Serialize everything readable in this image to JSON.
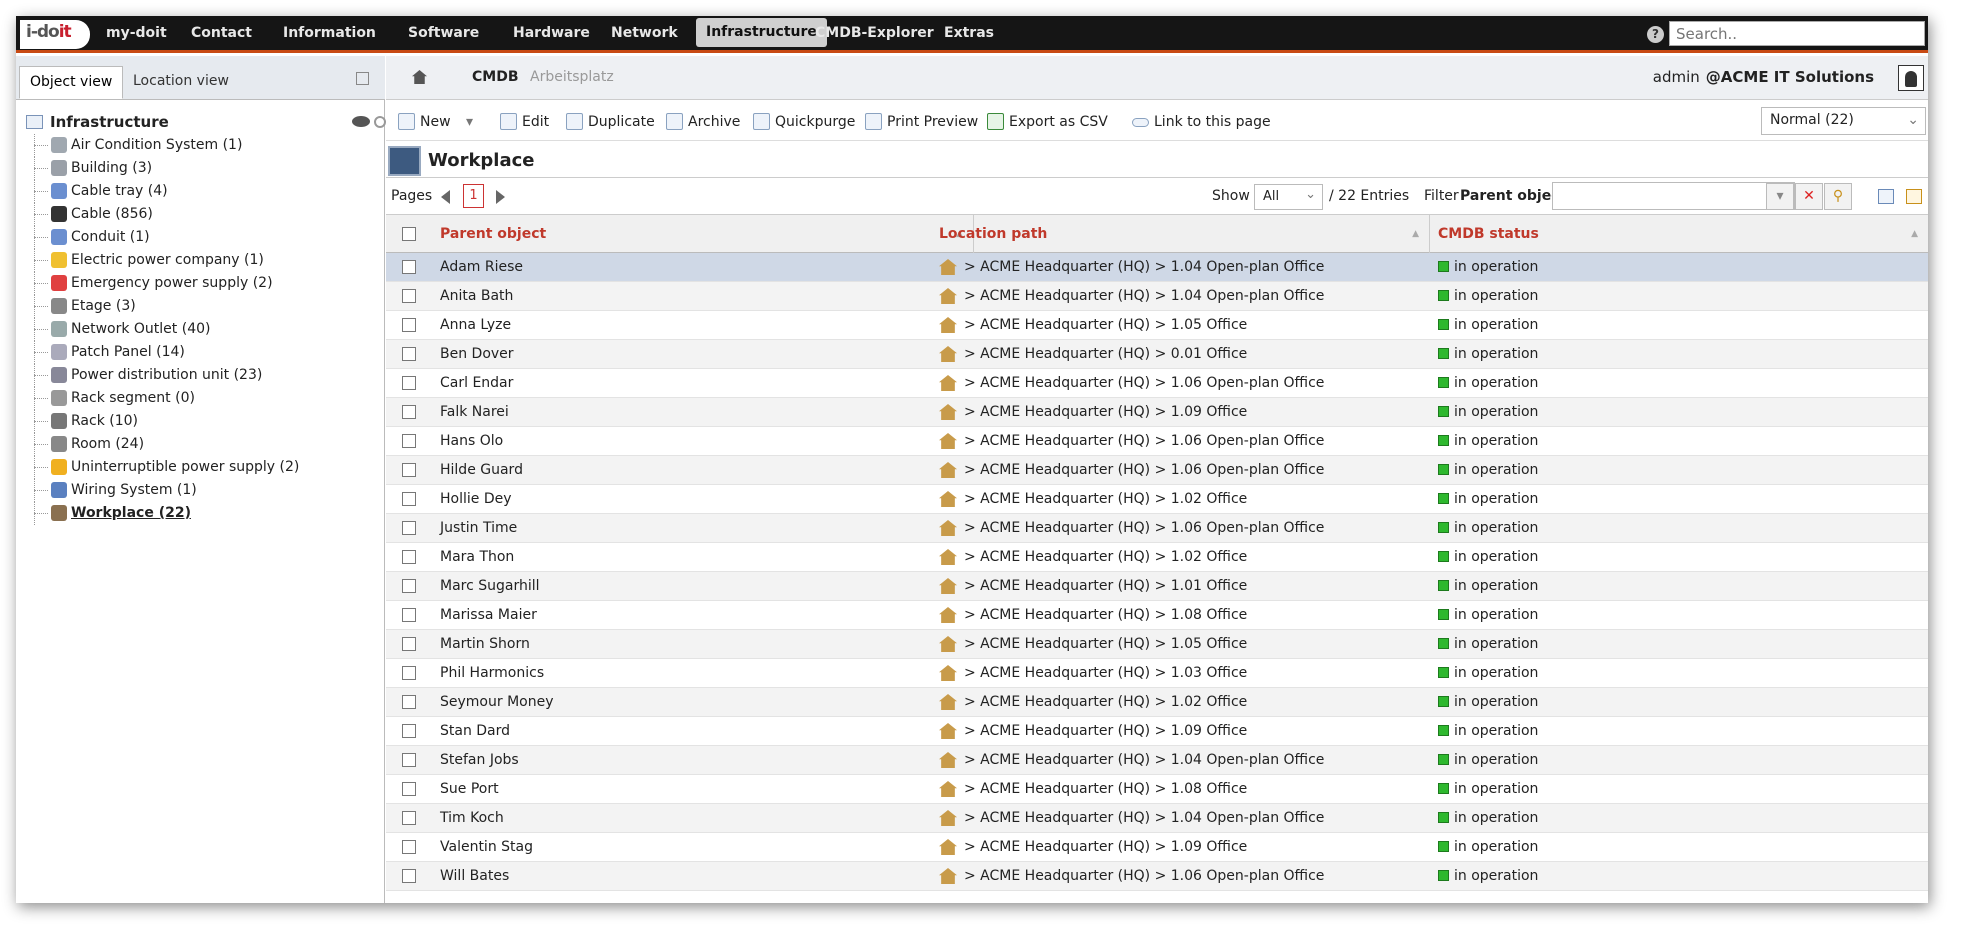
{
  "logo": {
    "text_a": "i-do",
    "text_b": "it"
  },
  "nav": [
    "my-doit",
    "Contact",
    "Information",
    "Software",
    "Hardware",
    "Network",
    "Infrastructure",
    "CMDB-Explorer",
    "Extras"
  ],
  "search": {
    "placeholder": "Search.."
  },
  "left_tabs": {
    "object_view": "Object view",
    "location_view": "Location view"
  },
  "tree": {
    "root": "Infrastructure",
    "items": [
      "Air Condition System (1)",
      "Building (3)",
      "Cable tray (4)",
      "Cable (856)",
      "Conduit (1)",
      "Electric power company (1)",
      "Emergency power supply (2)",
      "Etage (3)",
      "Network Outlet (40)",
      "Patch Panel (14)",
      "Power distribution unit (23)",
      "Rack segment (0)",
      "Rack (10)",
      "Room (24)",
      "Uninterruptible power supply (2)",
      "Wiring System (1)",
      "Workplace (22)"
    ]
  },
  "breadcrumb": {
    "cmdb": "CMDB",
    "current": "Arbeitsplatz"
  },
  "user": {
    "name": "admin",
    "org": "@ACME IT Solutions"
  },
  "toolbar": {
    "new": "New",
    "edit": "Edit",
    "duplicate": "Duplicate",
    "archive": "Archive",
    "quickpurge": "Quickpurge",
    "print": "Print Preview",
    "export": "Export as CSV",
    "link": "Link to this page",
    "view": "Normal (22)"
  },
  "object_type": "Workplace",
  "pager": {
    "label": "Pages",
    "page": "1",
    "show": "Show",
    "show_value": "All",
    "entries": "/ 22 Entries",
    "filter": "Filter",
    "filter_field": "Parent object"
  },
  "columns": [
    "Parent object",
    "Location path",
    "CMDB status"
  ],
  "rows": [
    {
      "parent": "Adam Riese",
      "location": "> ACME Headquarter (HQ) > 1.04 Open-plan Office",
      "status": "in operation"
    },
    {
      "parent": "Anita Bath",
      "location": "> ACME Headquarter (HQ) > 1.04 Open-plan Office",
      "status": "in operation"
    },
    {
      "parent": "Anna Lyze",
      "location": "> ACME Headquarter (HQ) > 1.05 Office",
      "status": "in operation"
    },
    {
      "parent": "Ben Dover",
      "location": "> ACME Headquarter (HQ) > 0.01 Office",
      "status": "in operation"
    },
    {
      "parent": "Carl Endar",
      "location": "> ACME Headquarter (HQ) > 1.06 Open-plan Office",
      "status": "in operation"
    },
    {
      "parent": "Falk Narei",
      "location": "> ACME Headquarter (HQ) > 1.09 Office",
      "status": "in operation"
    },
    {
      "parent": "Hans Olo",
      "location": "> ACME Headquarter (HQ) > 1.06 Open-plan Office",
      "status": "in operation"
    },
    {
      "parent": "Hilde Guard",
      "location": "> ACME Headquarter (HQ) > 1.06 Open-plan Office",
      "status": "in operation"
    },
    {
      "parent": "Hollie Dey",
      "location": "> ACME Headquarter (HQ) > 1.02 Office",
      "status": "in operation"
    },
    {
      "parent": "Justin Time",
      "location": "> ACME Headquarter (HQ) > 1.06 Open-plan Office",
      "status": "in operation"
    },
    {
      "parent": "Mara Thon",
      "location": "> ACME Headquarter (HQ) > 1.02 Office",
      "status": "in operation"
    },
    {
      "parent": "Marc Sugarhill",
      "location": "> ACME Headquarter (HQ) > 1.01 Office",
      "status": "in operation"
    },
    {
      "parent": "Marissa Maier",
      "location": "> ACME Headquarter (HQ) > 1.08 Office",
      "status": "in operation"
    },
    {
      "parent": "Martin Shorn",
      "location": "> ACME Headquarter (HQ) > 1.05 Office",
      "status": "in operation"
    },
    {
      "parent": "Phil Harmonics",
      "location": "> ACME Headquarter (HQ) > 1.03 Office",
      "status": "in operation"
    },
    {
      "parent": "Seymour Money",
      "location": "> ACME Headquarter (HQ) > 1.02 Office",
      "status": "in operation"
    },
    {
      "parent": "Stan Dard",
      "location": "> ACME Headquarter (HQ) > 1.09 Office",
      "status": "in operation"
    },
    {
      "parent": "Stefan Jobs",
      "location": "> ACME Headquarter (HQ) > 1.04 Open-plan Office",
      "status": "in operation"
    },
    {
      "parent": "Sue Port",
      "location": "> ACME Headquarter (HQ) > 1.08 Office",
      "status": "in operation"
    },
    {
      "parent": "Tim Koch",
      "location": "> ACME Headquarter (HQ) > 1.04 Open-plan Office",
      "status": "in operation"
    },
    {
      "parent": "Valentin Stag",
      "location": "> ACME Headquarter (HQ) > 1.09 Office",
      "status": "in operation"
    },
    {
      "parent": "Will Bates",
      "location": "> ACME Headquarter (HQ) > 1.06 Open-plan Office",
      "status": "in operation"
    }
  ],
  "colors": {
    "accent": "#c84a14",
    "header_text": "#c0392b",
    "status_ok": "#2eb82e"
  }
}
